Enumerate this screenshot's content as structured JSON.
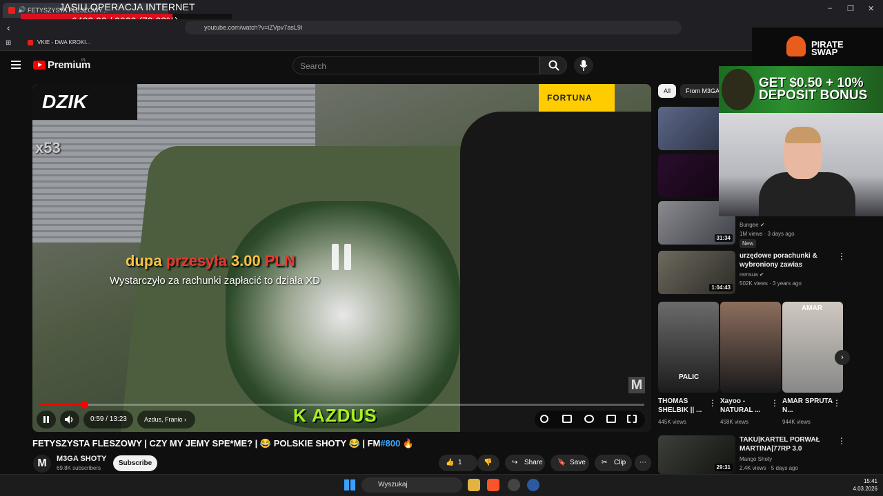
{
  "browser": {
    "tab_title": "FETYSZYSTA FLESZOWY...",
    "url": "youtube.com/watch?v=iZVpv7asL9I",
    "bookmark": "VKIE - DWA KROKI...",
    "min": "–",
    "max": "❐",
    "close": "✕"
  },
  "stream_overlay": {
    "title": "JASIU OPERACJA INTERNET",
    "goal_text": "6483.02 / 9000 (72.03%)",
    "goal_progress": 0.7203
  },
  "youtube": {
    "logo_text": "Premium",
    "logo_region": "PL",
    "search_placeholder": "Search"
  },
  "player": {
    "brand": "DZIK",
    "sponsor": "FORTUNA",
    "multiplier": "x53",
    "donation": {
      "name": "dupa",
      "action": "przesyła",
      "amount": "3.00",
      "currency": "PLN",
      "message": "Wystarczyło za rachunki zapłacić to działa XD"
    },
    "caption": "K AZDUS",
    "watermark": "M",
    "time": "0:59 / 13:23",
    "chapter": "Azdus, Franio",
    "progress": 0.074
  },
  "video": {
    "title_main": "FETYSZYSTA FLESZOWY | CZY MY JEMY SPE*ME? | 😂 POLSKIE SHOTY 😂 | FM",
    "title_hash": "#800",
    "title_end": " 🔥",
    "channel": "M3GA SHOTY",
    "channel_initial": "M",
    "subscribers": "69.8K subscribers",
    "subscribe": "Subscribe",
    "likes": "1",
    "share": "Share",
    "save": "Save",
    "clip": "Clip",
    "more": "⋯"
  },
  "recommendations": {
    "chips": [
      "All",
      "From M3GA"
    ],
    "items": [
      {
        "title": "",
        "channel": "Bungee",
        "meta": "1M views · 3 days ago",
        "badge": "New",
        "duration": "31:34"
      },
      {
        "title": "urzędowe porachunki & wybroniony zawias",
        "channel": "remsua",
        "meta": "502K views · 3 years ago",
        "duration": "1:04:43"
      },
      {
        "title": "TAKU|KARTEL PORWAŁ MARTINA|77RP 3.0",
        "channel": "Mango Shoty",
        "meta": "2.4K views · 5 days ago",
        "duration": "29:31"
      }
    ],
    "shorts": [
      {
        "title": "THOMAS SHELBIK || ...",
        "views": "445K views",
        "overlay": "PALIC"
      },
      {
        "title": "Xayoo - NATURAL ...",
        "views": "458K views",
        "overlay": ""
      },
      {
        "title": "AMAR SPRUTA N...",
        "views": "944K views",
        "overlay": "AMAR"
      }
    ]
  },
  "ads": {
    "brand": "PIRATE SWAP",
    "brand_line1": "PIRATE",
    "brand_line2": "SWAP",
    "bonus_line1": "GET $0.50 + 10%",
    "bonus_line2": "DEPOSIT BONUS"
  },
  "taskbar": {
    "search": "Wyszukaj",
    "time": "15:41",
    "date": "4.03.2026"
  }
}
